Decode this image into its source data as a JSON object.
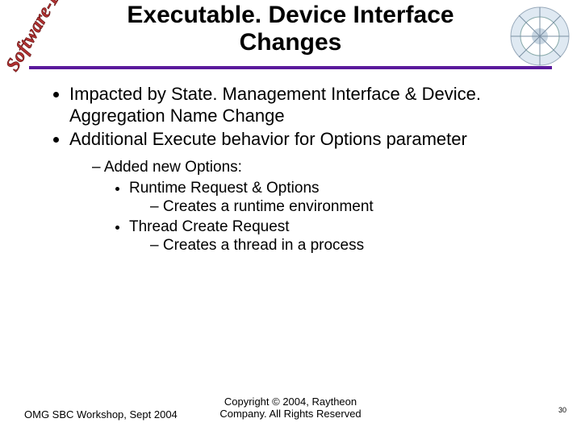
{
  "title_line1": "Executable. Device Interface",
  "title_line2": "Changes",
  "side_text": "Software-Based",
  "logo_label": "Model Driven Architecture",
  "bullets": {
    "b1": "Impacted by State. Management Interface & Device. Aggregation Name Change",
    "b2": "Additional Execute behavior for Options parameter",
    "s1": "Added new Options:",
    "s2a": "Runtime Request & Options",
    "s2a_d": "Creates a runtime environment",
    "s2b": "Thread Create Request",
    "s2b_d": "Creates a thread in a process"
  },
  "footer": {
    "left": "OMG SBC Workshop, Sept 2004",
    "center_l1": "Copyright © 2004, Raytheon",
    "center_l2": "Company. All Rights Reserved",
    "page": "30"
  },
  "colors": {
    "rule": "#5a1a9c"
  }
}
